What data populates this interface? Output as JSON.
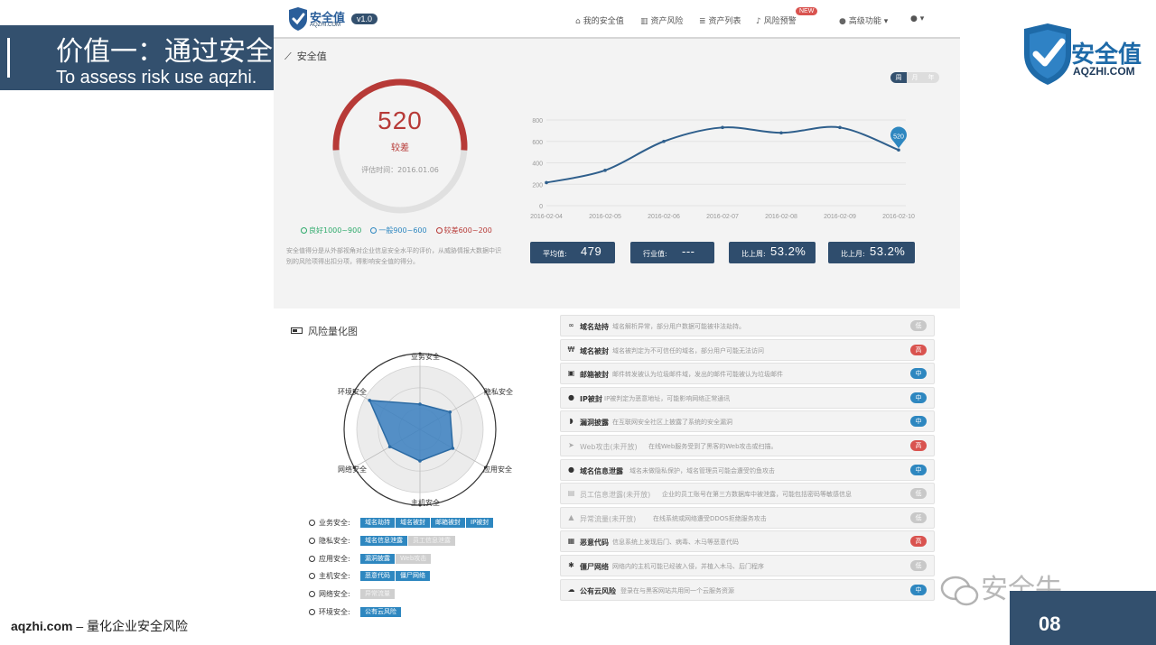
{
  "slide": {
    "title": "价值一：通过安全",
    "subtitle": "To assess risk use aqzhi.",
    "brand_name": "安全值",
    "brand_domain": "AQZHI.COM",
    "footer_domain": "aqzhi.com",
    "footer_text": " – 量化企业安全风险",
    "page_number": "08",
    "watermark": "安全牛",
    "colors": {
      "navy": "#33506e",
      "brand_blue": "#1e6aa8",
      "red": "#b73a37"
    }
  },
  "app": {
    "logo_text": "安全值",
    "logo_domain": "AQZHI.COM",
    "version": "v1.0",
    "nav": [
      {
        "label": "我的安全值",
        "icon": "home-icon"
      },
      {
        "label": "资产风险",
        "icon": "bar-chart-icon"
      },
      {
        "label": "资产列表",
        "icon": "database-icon"
      },
      {
        "label": "风险预警",
        "icon": "bell-icon"
      },
      {
        "label": "高级功能",
        "icon": "globe-icon"
      }
    ],
    "new_badge": "NEW",
    "section_title": "安全值",
    "period_toggle": [
      "周",
      "月",
      "年"
    ],
    "score": {
      "value": "520",
      "label": "较差",
      "date": "评估时间：2016.01.06",
      "ring_fraction": 0.52
    },
    "score_legend": [
      {
        "label": "良好1000~900",
        "color": "#2eaa6b"
      },
      {
        "label": "一般900~600",
        "color": "#2e87c0"
      },
      {
        "label": "较差600~200",
        "color": "#b73a37"
      }
    ],
    "description": "安全值得分是从外部视角对企业信息安全水平的评价，从威胁情报大数据中识别的风险项得出扣分项，得影响安全值的得分。",
    "stats": [
      {
        "label": "平均值:",
        "value": "479"
      },
      {
        "label": "行业值:",
        "value": "---"
      },
      {
        "label": "比上周:",
        "value": "53.2%"
      },
      {
        "label": "比上月:",
        "value": "53.2%"
      }
    ]
  },
  "chart_data": {
    "type": "line",
    "x": [
      "2016-02-04",
      "2016-02-05",
      "2016-02-06",
      "2016-02-07",
      "2016-02-08",
      "2016-02-09",
      "2016-02-10"
    ],
    "series": [
      {
        "values": [
          215,
          330,
          600,
          730,
          680,
          730,
          520
        ]
      }
    ],
    "yticks": [
      0,
      200,
      400,
      600,
      800
    ],
    "ylim": [
      0,
      800
    ],
    "last_point_label": "520",
    "grid": true
  },
  "radar": {
    "title": "风险量化图",
    "axes": [
      "业务安全",
      "隐私安全",
      "应用安全",
      "主机安全",
      "网络安全",
      "环境安全"
    ],
    "values": [
      0.4,
      0.55,
      0.6,
      0.5,
      0.55,
      0.92
    ],
    "fill_color": "#3a7fc0"
  },
  "categories": [
    {
      "name": "业务安全:",
      "tags": [
        {
          "t": "域名劫持",
          "on": true
        },
        {
          "t": "域名被封",
          "on": true
        },
        {
          "t": "邮箱被封",
          "on": true
        },
        {
          "t": "IP被封",
          "on": true
        }
      ]
    },
    {
      "name": "隐私安全:",
      "tags": [
        {
          "t": "域名信息泄露",
          "on": true
        },
        {
          "t": "员工信息泄露",
          "on": false
        }
      ]
    },
    {
      "name": "应用安全:",
      "tags": [
        {
          "t": "漏洞披露",
          "on": true
        },
        {
          "t": "Web攻击",
          "on": false
        }
      ]
    },
    {
      "name": "主机安全:",
      "tags": [
        {
          "t": "恶意代码",
          "on": true
        },
        {
          "t": "僵尸网络",
          "on": true
        }
      ]
    },
    {
      "name": "网络安全:",
      "tags": [
        {
          "t": "异常流量",
          "on": false
        }
      ]
    },
    {
      "name": "环境安全:",
      "tags": [
        {
          "t": "公有云风险",
          "on": true
        }
      ]
    }
  ],
  "risks": [
    {
      "name": "域名劫持",
      "icon": "link-icon",
      "desc": "域名解析异常，部分用户数据可能被非法劫持。",
      "level": "低",
      "lv": "low",
      "dim": false
    },
    {
      "name": "域名被封",
      "icon": "w-icon",
      "desc": "域名被判定为不可信任的域名，部分用户可能无法访问",
      "level": "高",
      "lv": "high",
      "dim": false
    },
    {
      "name": "邮箱被封",
      "icon": "mail-icon",
      "desc": "邮件转发被认为垃圾邮件域，发出的邮件可能被认为垃圾邮件",
      "level": "中",
      "lv": "mid",
      "dim": false
    },
    {
      "name": "IP被封",
      "icon": "globe-icon",
      "desc": "IP被判定为恶意地址，可能影响网络正常通讯",
      "level": "中",
      "lv": "mid",
      "dim": false
    },
    {
      "name": "漏洞披露",
      "icon": "shield-icon",
      "desc": "在互联网安全社区上披露了系统的安全漏洞",
      "level": "中",
      "lv": "mid",
      "dim": false
    },
    {
      "name": "Web攻击(未开放)",
      "icon": "send-icon",
      "desc": "在线Web服务受到了黑客的Web攻击或扫描。",
      "level": "高",
      "lv": "high",
      "dim": true
    },
    {
      "name": "域名信息泄露",
      "icon": "info-icon",
      "desc": "域名未做隐私保护，域名管理员可能会遭受钓鱼攻击",
      "level": "中",
      "lv": "mid",
      "dim": false
    },
    {
      "name": "员工信息泄露(未开放)",
      "icon": "doc-icon",
      "desc": "企业的员工账号在第三方数据库中被泄露，可能包括密码等敏感信息",
      "level": "低",
      "lv": "low",
      "dim": true
    },
    {
      "name": "异常流量(未开放)",
      "icon": "warning-icon",
      "desc": "在线系统或网络遭受DDOS拒绝服务攻击",
      "level": "低",
      "lv": "low",
      "dim": true
    },
    {
      "name": "恶意代码",
      "icon": "bug-icon",
      "desc": "信息系统上发现后门、病毒、木马等恶意代码",
      "level": "高",
      "lv": "high",
      "dim": false
    },
    {
      "name": "僵尸网络",
      "icon": "users-icon",
      "desc": "网络内的主机可能已经被入侵，并植入木马、后门程序",
      "level": "低",
      "lv": "low",
      "dim": false
    },
    {
      "name": "公有云风险",
      "icon": "cloud-icon",
      "desc": "登录在与黑客网站共用同一个云服务资源",
      "level": "中",
      "lv": "mid",
      "dim": false
    }
  ]
}
